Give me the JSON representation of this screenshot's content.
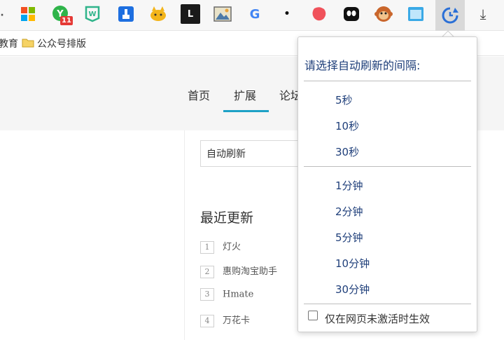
{
  "toolbar": {
    "badge_count": "11",
    "extensions": [
      {
        "icon": "windows-tiles-icon"
      },
      {
        "icon": "green-y-icon"
      },
      {
        "icon": "green-w-icon"
      },
      {
        "icon": "blue-hand-icon"
      },
      {
        "icon": "yellow-cat-icon"
      },
      {
        "icon": "black-l-icon",
        "text": "L"
      },
      {
        "icon": "image-icon"
      },
      {
        "icon": "google-icon",
        "text": "G"
      },
      {
        "icon": "dot-icon",
        "text": "•"
      },
      {
        "icon": "red-blob-icon"
      },
      {
        "icon": "black-face-icon"
      },
      {
        "icon": "monkey-icon"
      },
      {
        "icon": "blue-window-icon"
      },
      {
        "icon": "auto-refresh-icon"
      },
      {
        "icon": "download-icon",
        "text": "⤓"
      }
    ]
  },
  "bookmarks": {
    "partial_item": "教育",
    "folder_label": "公众号排版"
  },
  "page": {
    "nav": [
      "首页",
      "扩展",
      "论坛"
    ],
    "search_value": "自动刷新",
    "recent_title": "最近更新",
    "recent_items": [
      {
        "num": "1",
        "label": "灯火"
      },
      {
        "num": "2",
        "label": "惠购淘宝助手"
      },
      {
        "num": "3",
        "label": "Hmate"
      },
      {
        "num": "4",
        "label": "万花卡"
      }
    ]
  },
  "popup": {
    "title": "请选择自动刷新的间隔:",
    "seconds_options": [
      "5秒",
      "10秒",
      "30秒"
    ],
    "minute_options": [
      "1分钟",
      "2分钟",
      "5分钟",
      "10分钟",
      "30分钟"
    ],
    "checkbox_label": "仅在网页未激活时生效",
    "checkbox_checked": false
  },
  "colors": {
    "accent": "#1da1c6",
    "popup_text": "#1f3f7a",
    "badge": "#e53935"
  }
}
